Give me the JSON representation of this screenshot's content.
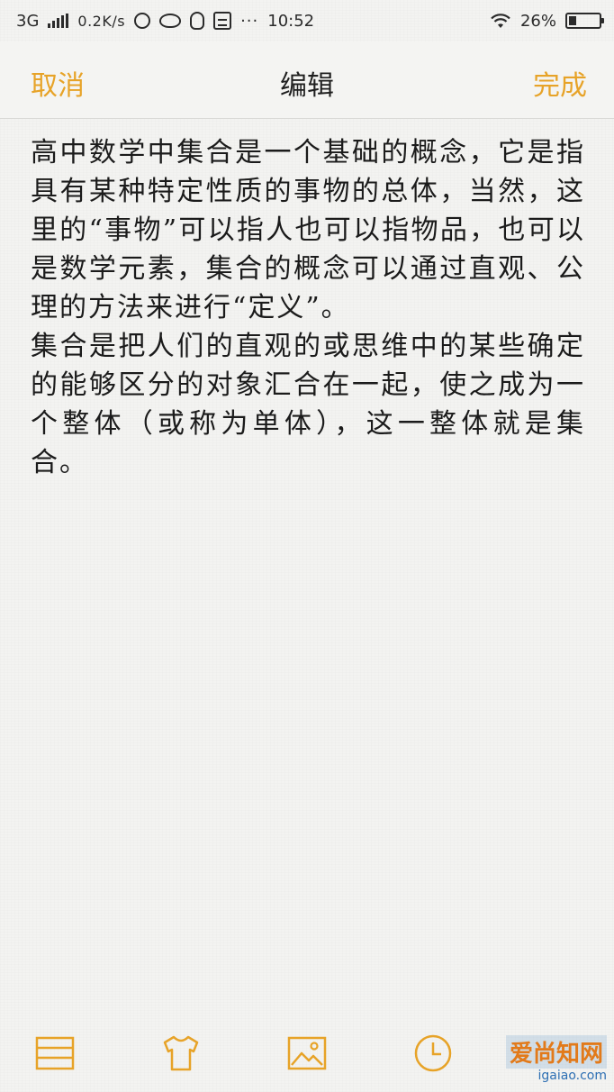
{
  "status_bar": {
    "network": "3G",
    "speed": "0.2K/s",
    "dots": "···",
    "time": "10:52",
    "battery": "26%",
    "battery_level": 0.26
  },
  "nav": {
    "cancel_label": "取消",
    "title": "编辑",
    "done_label": "完成"
  },
  "note": {
    "paragraphs": [
      "高中数学中集合是一个基础的概念，它是指具有某种特定性质的事物的总体，当然，这里的“事物”可以指人也可以指物品，也可以是数学元素，集合的概念可以通过直观、公理的方法来进行“定义”。",
      "集合是把人们的直观的或思维中的某些确定的能够区分的对象汇合在一起，使之成为一个整体（或称为单体），这一整体就是集合。"
    ]
  },
  "toolbar": {
    "icons": [
      "list-icon",
      "shirt-icon",
      "image-icon",
      "clock-icon"
    ],
    "accent_color": "#e7a328"
  },
  "watermark": {
    "main": "爱尚知网",
    "url": "igaiao.com"
  }
}
